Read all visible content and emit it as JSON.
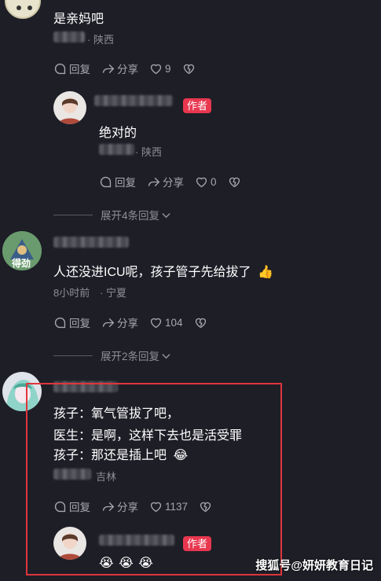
{
  "comment1": {
    "text": "是亲妈吧",
    "location": "· 陕西",
    "reply": "回复",
    "share": "分享",
    "likes": "9"
  },
  "reply1": {
    "author_tag": "作者",
    "text": "绝对的",
    "location": "· 陕西",
    "reply": "回复",
    "share": "分享",
    "likes": "0"
  },
  "expand1": {
    "label": "展开4条回复"
  },
  "comment2": {
    "text": "人还没进ICU呢，孩子管子先给拔了",
    "emoji": "👍",
    "time": "8小时前",
    "location": "· 宁夏",
    "reply": "回复",
    "share": "分享",
    "likes": "104",
    "avatar_label": "得劲"
  },
  "expand2": {
    "label": "展开2条回复"
  },
  "comment3": {
    "line1": "孩子：氧气管拔了吧，",
    "line2": "医生：是啊，这样下去也是活受罪",
    "line3": "孩子：那还是插上吧",
    "emoji": "😂",
    "location": "吉林",
    "reply": "回复",
    "share": "分享",
    "likes": "1137"
  },
  "reply2": {
    "author_tag": "作者",
    "emojis": "😭 😭 😭"
  },
  "watermark": "搜狐号@妍妍教育日记",
  "colors": {
    "background": "#1e1e27",
    "author_tag": "#e8374f",
    "highlight_border": "#e0353d",
    "meta": "#8e8e98"
  }
}
